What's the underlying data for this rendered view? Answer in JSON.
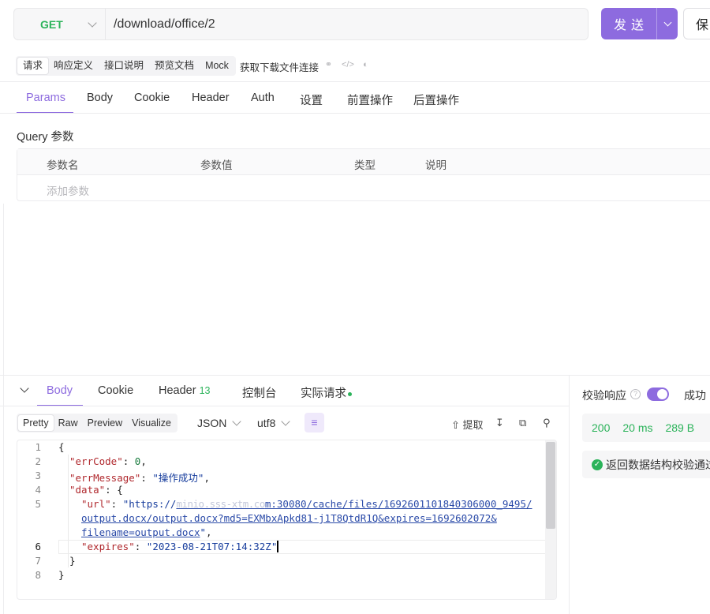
{
  "request": {
    "method": "GET",
    "url": "/download/office/2",
    "send_label": "发送",
    "save_label": "保"
  },
  "doc_tabs": [
    "请求",
    "响应定义",
    "接口说明",
    "预览文档",
    "Mock"
  ],
  "api_name": "获取下载文件连接",
  "param_tabs": [
    "Params",
    "Body",
    "Cookie",
    "Header",
    "Auth",
    "设置",
    "前置操作",
    "后置操作"
  ],
  "query": {
    "title": "Query 参数",
    "columns": [
      "参数名",
      "参数值",
      "类型",
      "说明"
    ],
    "add_placeholder": "添加参数"
  },
  "response": {
    "tabs": [
      "Body",
      "Cookie",
      "Header",
      "控制台",
      "实际请求"
    ],
    "header_count": "13",
    "format_tabs": [
      "Pretty",
      "Raw",
      "Preview",
      "Visualize"
    ],
    "format": "JSON",
    "encoding": "utf8",
    "extract_label": "提取"
  },
  "code": {
    "line_numbers": [
      "1",
      "2",
      "3",
      "4",
      "5",
      "6",
      "7",
      "8"
    ],
    "err_code_key": "\"errCode\"",
    "err_code_value": "0",
    "err_message_key": "\"errMessage\"",
    "err_message_value": "\"操作成功\"",
    "data_key": "\"data\"",
    "url_key": "\"url\"",
    "url_line1_prefix": "\"https://",
    "url_line1_blurred": "minio.sss-xtm.co",
    "url_line1_suffix": "m:30080/cache/files/1692601101840306000_9495/",
    "url_line2": "output.docx/output.docx?md5=EXMbxApkd81-j1T8QtdR1Q&expires=1692602072&",
    "url_line3": "filename=output.docx",
    "expires_key": "\"expires\"",
    "expires_value": "\"2023-08-21T07:14:32Z\""
  },
  "validation": {
    "label": "校验响应",
    "status": "成功",
    "status_code": "200",
    "time": "20 ms",
    "size": "289 B",
    "message": "返回数据结构校验通过"
  }
}
